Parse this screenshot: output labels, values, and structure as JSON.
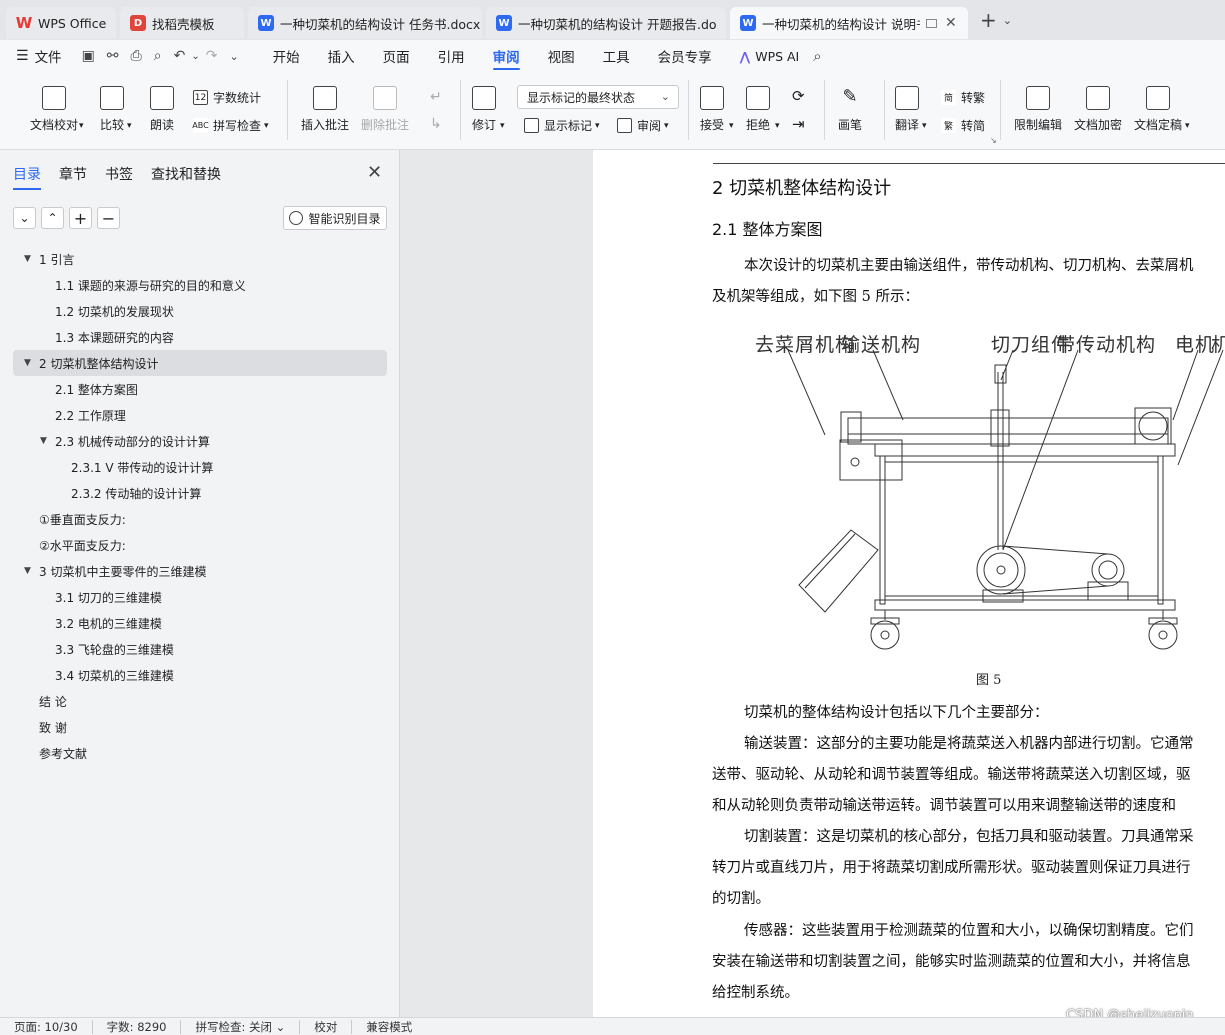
{
  "tabs": [
    {
      "label": "WPS Office",
      "icon": "wps-logo-icon"
    },
    {
      "label": "找稻壳模板",
      "icon": "docer-icon"
    },
    {
      "label": "一种切菜机的结构设计 任务书.docx",
      "icon": "word-doc-icon"
    },
    {
      "label": "一种切菜机的结构设计 开题报告.docx",
      "icon": "word-doc-icon"
    },
    {
      "label": "一种切菜机的结构设计 说明书",
      "icon": "word-doc-icon",
      "active": true
    }
  ],
  "menu": {
    "file": "文件",
    "items": [
      "开始",
      "插入",
      "页面",
      "引用",
      "审阅",
      "视图",
      "工具",
      "会员专享"
    ],
    "active": "审阅",
    "ai": "WPS AI"
  },
  "ribbon": {
    "proofread": "文档校对",
    "compare": "比较",
    "read_aloud": "朗读",
    "word_count": "字数统计",
    "spell_check": "拼写检查",
    "insert_comment": "插入批注",
    "delete_comment": "删除批注",
    "revise": "修订",
    "markup_state": "显示标记的最终状态",
    "show_markup": "显示标记",
    "review": "审阅",
    "accept": "接受",
    "reject": "拒绝",
    "pen": "画笔",
    "translate": "翻译",
    "to_traditional": "转繁",
    "to_simplified": "转简",
    "restrict_edit": "限制编辑",
    "encrypt": "文档加密",
    "finalize": "文档定稿"
  },
  "nav": {
    "tabs": [
      "目录",
      "章节",
      "书签",
      "查找和替换"
    ],
    "active_tab": "目录",
    "smart_btn": "智能识别目录",
    "toc": [
      {
        "text": "1  引言",
        "level": 1,
        "expanded": true
      },
      {
        "text": "1.1  课题的来源与研究的目的和意义",
        "level": 2
      },
      {
        "text": "1.2  切菜机的发展现状",
        "level": 2
      },
      {
        "text": "1.3  本课题研究的内容",
        "level": 2
      },
      {
        "text": "2  切菜机整体结构设计",
        "level": 1,
        "expanded": true,
        "selected": true
      },
      {
        "text": "2.1  整体方案图",
        "level": 2
      },
      {
        "text": "2.2  工作原理",
        "level": 2
      },
      {
        "text": "2.3  机械传动部分的设计计算",
        "level": 2,
        "expanded": true
      },
      {
        "text": "2.3.1 V 带传动的设计计算",
        "level": 3
      },
      {
        "text": "2.3.2 传动轴的设计计算",
        "level": 3
      },
      {
        "text": "①垂直面支反力:",
        "level": 0
      },
      {
        "text": "②水平面支反力:",
        "level": 0
      },
      {
        "text": "3  切菜机中主要零件的三维建模",
        "level": 1,
        "expanded": true
      },
      {
        "text": "3.1 切刀的三维建模",
        "level": 2
      },
      {
        "text": "3.2  电机的三维建模",
        "level": 2
      },
      {
        "text": "3.3 飞轮盘的三维建模",
        "level": 2
      },
      {
        "text": "3.4 切菜机的三维建模",
        "level": 2
      },
      {
        "text": "结    论",
        "level": 0
      },
      {
        "text": "致    谢",
        "level": 0
      },
      {
        "text": "参考文献",
        "level": 0
      }
    ]
  },
  "doc": {
    "h1": "2  切菜机整体结构设计",
    "h2": "2.1  整体方案图",
    "para1_l1": "本次设计的切菜机主要由输送组件，带传动机构、切刀机构、去菜屑机",
    "para1_l2": "及机架等组成，如下图 5 所示：",
    "fig_labels": [
      "去菜屑机构",
      "输送机构",
      "切刀组件",
      "带传动机构",
      "电机",
      "机"
    ],
    "caption": "图 5",
    "lines": [
      "切菜机的整体结构设计包括以下几个主要部分：",
      "输送装置：这部分的主要功能是将蔬菜送入机器内部进行切割。它通常",
      "送带、驱动轮、从动轮和调节装置等组成。输送带将蔬菜送入切割区域，驱",
      "和从动轮则负责带动输送带运转。调节装置可以用来调整输送带的速度和",
      "切割装置：这是切菜机的核心部分，包括刀具和驱动装置。刀具通常采",
      "转刀片或直线刀片，用于将蔬菜切割成所需形状。驱动装置则保证刀具进行",
      "的切割。",
      "传感器：这些装置用于检测蔬菜的位置和大小，以确保切割精度。它们",
      "安装在输送带和切割装置之间，能够实时监测蔬菜的位置和大小，并将信息",
      "给控制系统。"
    ]
  },
  "status": {
    "page": "页面: 10/30",
    "words": "字数: 8290",
    "spell": "拼写检查: 关闭",
    "proof": "校对",
    "compat": "兼容模式"
  },
  "watermark": "CSDN @shejizuopin"
}
